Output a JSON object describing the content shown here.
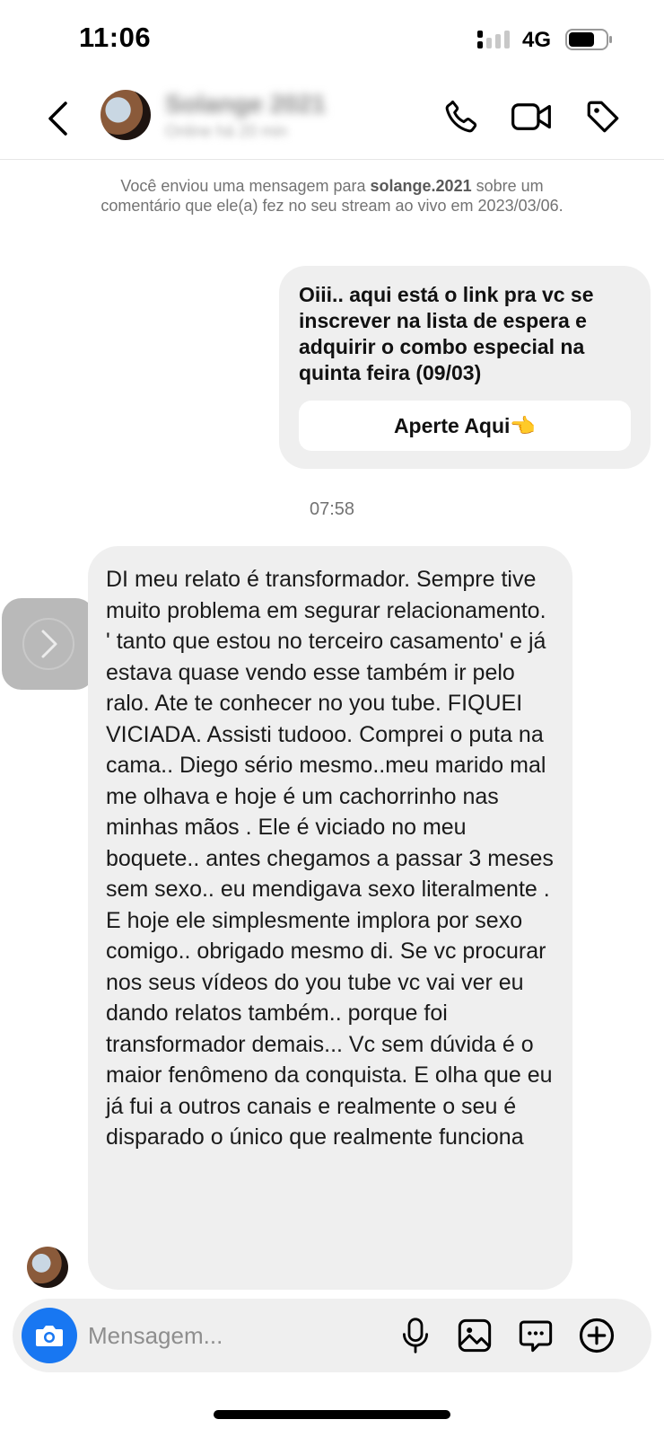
{
  "status_bar": {
    "time": "11:06",
    "network": "4G"
  },
  "header": {
    "contact_name": "Solange 2021",
    "contact_status": "Online há 20 min",
    "icons": [
      "back-chevron-icon",
      "phone-icon",
      "video-camera-icon",
      "tag-icon"
    ]
  },
  "info": {
    "prefix": "Você enviou uma mensagem para ",
    "username": "solange.2021",
    "suffix": " sobre um comentário que ele(a) fez no seu stream ao vivo em 2023/03/06."
  },
  "outgoing_message": {
    "text": "Oiii.. aqui está o link pra vc se inscrever na lista de espera e adquirir o combo especial na quinta feira (09/03)",
    "button_label": "Aperte Aqui👈"
  },
  "timestamp": "07:58",
  "incoming_message": {
    "text": "DI meu relato é transformador. Sempre tive muito problema em segurar relacionamento. ' tanto que estou no terceiro casamento' e já estava quase vendo esse também ir pelo ralo. Ate te conhecer no you tube.  FIQUEI VICIADA. Assisti tudooo. Comprei o puta na cama.. Diego sério mesmo..meu marido mal me olhava e hoje é um cachorrinho nas minhas mãos . Ele é viciado no meu boquete.. antes chegamos a passar 3 meses sem sexo.. eu mendigava sexo literalmente . E hoje ele simplesmente implora por sexo comigo.. obrigado mesmo di. Se vc procurar nos seus vídeos do you tube vc vai ver eu dando relatos também.. porque foi transformador demais... Vc sem dúvida é o maior fenômeno da conquista. E olha que eu já fui a outros canais e realmente o seu é disparado o único que realmente funciona"
  },
  "composer": {
    "placeholder": "Mensagem...",
    "value": "",
    "icons": [
      "camera-icon",
      "microphone-icon",
      "gallery-icon",
      "sticker-icon",
      "plus-icon"
    ],
    "accent_color": "#1877f2"
  }
}
